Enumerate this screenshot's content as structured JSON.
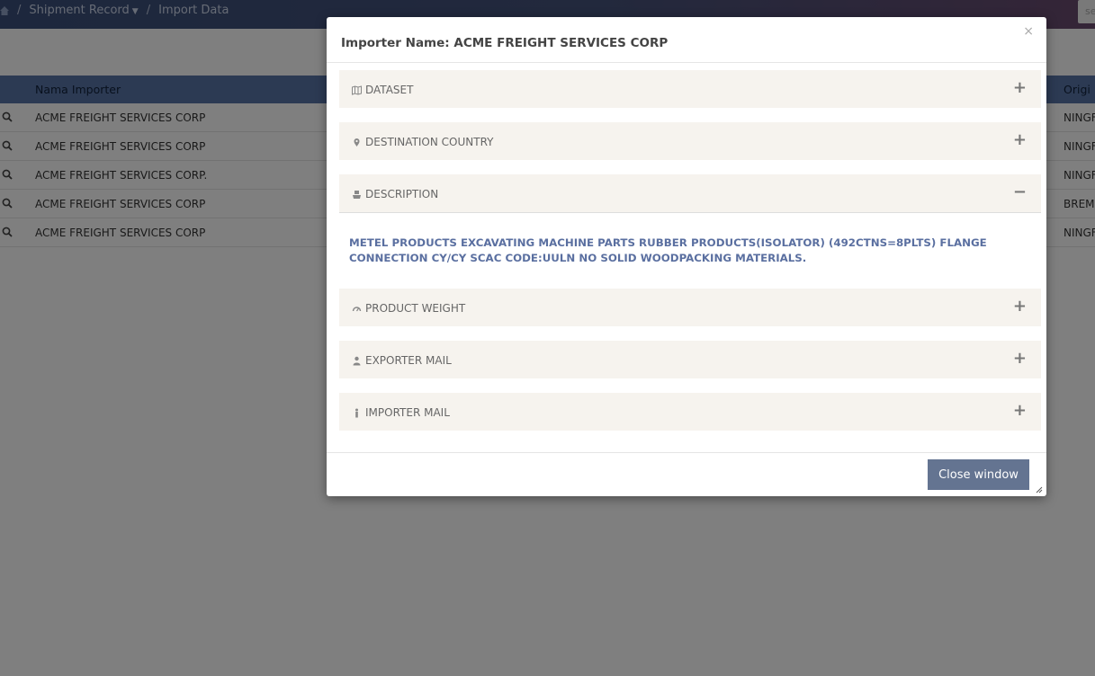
{
  "breadcrumb": {
    "separator": "/",
    "items": [
      "Shipment Record",
      "Import Data"
    ]
  },
  "search": {
    "placeholder": "se"
  },
  "table": {
    "headers": {
      "name": "Nama Importer",
      "origin": "Origi"
    },
    "rows": [
      {
        "name": "ACME FREIGHT SERVICES CORP",
        "origin": "NINGF"
      },
      {
        "name": "ACME FREIGHT SERVICES CORP",
        "origin": "NINGF"
      },
      {
        "name": "ACME FREIGHT SERVICES CORP.",
        "origin": "NINGF"
      },
      {
        "name": "ACME FREIGHT SERVICES CORP",
        "origin": "BREME"
      },
      {
        "name": "ACME FREIGHT SERVICES CORP",
        "origin": "NINGF"
      }
    ]
  },
  "modal": {
    "title": "Importer Name: ACME FREIGHT SERVICES CORP",
    "close_symbol": "×",
    "panels": [
      {
        "icon": "map-icon",
        "label": "DATASET",
        "toggle": "+"
      },
      {
        "icon": "map-marker-icon",
        "label": "DESTINATION COUNTRY",
        "toggle": "+"
      },
      {
        "icon": "ship-icon",
        "label": "DESCRIPTION",
        "toggle": "−"
      },
      {
        "icon": "dashboard-icon",
        "label": "PRODUCT WEIGHT",
        "toggle": "+"
      },
      {
        "icon": "user-icon",
        "label": "EXPORTER MAIL",
        "toggle": "+"
      },
      {
        "icon": "person-icon",
        "label": "IMPORTER MAIL",
        "toggle": "+"
      }
    ],
    "description_text": "METEL PRODUCTS EXCAVATING MACHINE PARTS RUBBER PRODUCTS(ISOLATOR) (492CTNS=8PLTS) FLANGE CONNECTION CY/CY SCAC CODE:UULN NO SOLID WOODPACKING MATERIALS.",
    "close_button": "Close window"
  },
  "colors": {
    "table_header": "#5875a6",
    "button": "#647491",
    "description_text": "#5a6fa0",
    "panel_bg": "#f6f3ee"
  }
}
